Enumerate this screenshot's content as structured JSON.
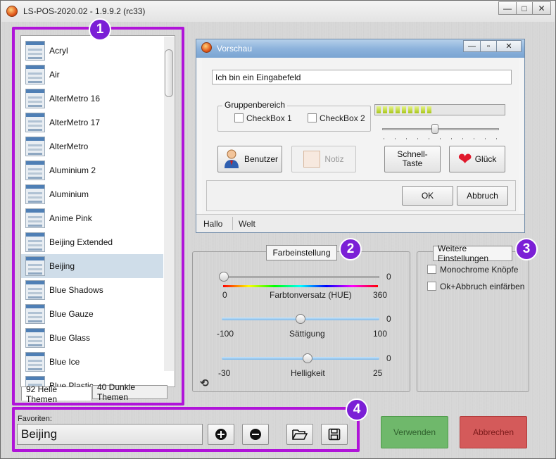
{
  "window": {
    "title": "LS-POS-2020.02 - 1.9.9.2 (rc33)",
    "controls": {
      "minimize": "—",
      "maximize": "□",
      "close": "✕"
    }
  },
  "themes": {
    "items": [
      "Acryl",
      "Air",
      "AlterMetro 16",
      "AlterMetro 17",
      "AlterMetro",
      "Aluminium 2",
      "Aluminium",
      "Anime Pink",
      "Beijing Extended",
      "Beijing",
      "Blue Shadows",
      "Blue Gauze",
      "Blue Glass",
      "Blue Ice",
      "Blue Plastic"
    ],
    "selected_index": 9,
    "tab_light": "92 Helle Themen",
    "tab_dark": "40 Dunkle Themen"
  },
  "badges": [
    "1",
    "2",
    "3",
    "4"
  ],
  "preview": {
    "title": "Vorschau",
    "controls": {
      "minimize": "—",
      "maximize": "▫",
      "close": "✕"
    },
    "input_value": "Ich bin ein Eingabefeld",
    "group_label": "Gruppenbereich",
    "checkbox1": "CheckBox 1",
    "checkbox2": "CheckBox 2",
    "progress_segments": 9,
    "progress_value_fraction": 0.43,
    "slider_value_fraction": 0.45,
    "btn_user": "Benutzer",
    "btn_note": "Notiz",
    "btn_quick": "Schnell-Taste",
    "btn_luck": "Glück",
    "btn_ok": "OK",
    "btn_cancel": "Abbruch",
    "status1": "Hallo",
    "status2": "Welt"
  },
  "color_settings": {
    "title": "Farbeinstellung",
    "hue": {
      "label": "Farbtonversatz (HUE)",
      "min": "0",
      "max": "360",
      "value": "0",
      "fraction": 0.0
    },
    "saturation": {
      "label": "Sättigung",
      "min": "-100",
      "max": "100",
      "value": "0",
      "fraction": 0.5
    },
    "brightness": {
      "label": "Helligkeit",
      "min": "-30",
      "max": "25",
      "value": "0",
      "fraction": 0.545
    }
  },
  "more_settings": {
    "title": "Weitere Einstellungen",
    "opt1": "Monochrome Knöpfe",
    "opt2": "Ok+Abbruch einfärben"
  },
  "favorites": {
    "label": "Favoriten:",
    "value": "Beijing"
  },
  "actions": {
    "apply": "Verwenden",
    "cancel": "Abbrechen"
  },
  "colors": {
    "highlight": "#b014d9",
    "badge": "#7b1fd6",
    "apply_bg": "#6fb86b",
    "cancel_bg": "#d45a5a",
    "selected_row": "#cfdde9"
  }
}
